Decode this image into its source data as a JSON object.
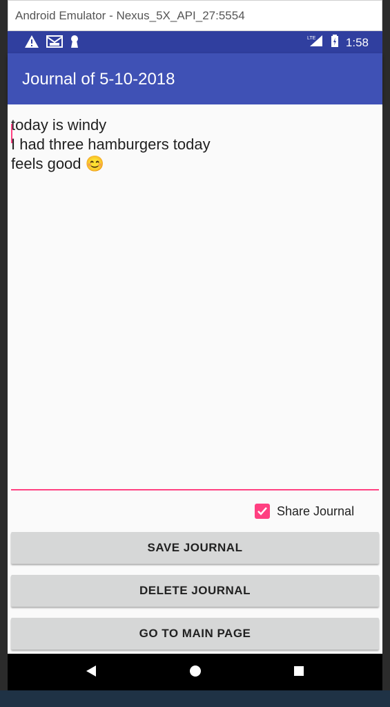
{
  "emulator": {
    "title": "Android Emulator - Nexus_5X_API_27:5554"
  },
  "status_bar": {
    "time": "1:58",
    "network_label": "LTE",
    "icons": [
      "warning-icon",
      "mail-icon",
      "keyhole-icon",
      "signal-icon",
      "battery-charging-icon"
    ]
  },
  "app_bar": {
    "title": "Journal of 5-10-2018"
  },
  "editor": {
    "lines": [
      "today is windy",
      "I had three hamburgers today",
      "feels good 😊"
    ]
  },
  "share": {
    "label": "Share Journal",
    "checked": true
  },
  "buttons": {
    "save": "SAVE JOURNAL",
    "delete": "DELETE JOURNAL",
    "main_page": "GO TO MAIN PAGE"
  },
  "nav": {
    "icons": [
      "back-icon",
      "home-icon",
      "recents-icon"
    ]
  },
  "colors": {
    "status_bar": "#303f9f",
    "app_bar": "#3f51b5",
    "accent": "#ff4081",
    "button_bg": "#d6d7d7"
  }
}
